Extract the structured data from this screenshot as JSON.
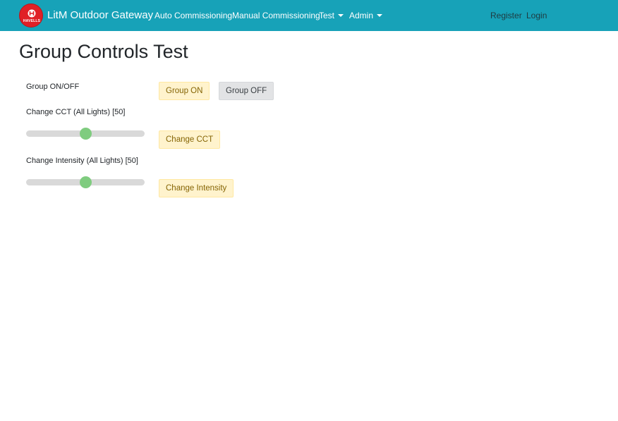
{
  "navbar": {
    "logo_text": "HAVELLS",
    "brand": "LitM Outdoor Gateway",
    "links": {
      "auto": "Auto Commissioning",
      "manual": "Manual Commissioning",
      "test": "Test",
      "admin": "Admin",
      "register": "Register",
      "login": "Login"
    },
    "colors": {
      "background": "#17a2b8",
      "logo": "#e02026"
    }
  },
  "page": {
    "title": "Group Controls Test",
    "group_onoff": {
      "label": "Group ON/OFF",
      "on_label": "Group ON",
      "off_label": "Group OFF"
    },
    "cct": {
      "label": "Change CCT (All Lights) [50]",
      "value": 50,
      "button": "Change CCT"
    },
    "intensity": {
      "label": "Change Intensity (All Lights) [50]",
      "value": 50,
      "button": "Change Intensity"
    }
  },
  "colors": {
    "warning_bg": "#fff3cd",
    "secondary_bg": "#e2e3e5",
    "slider_thumb": "#7fcc7f"
  }
}
